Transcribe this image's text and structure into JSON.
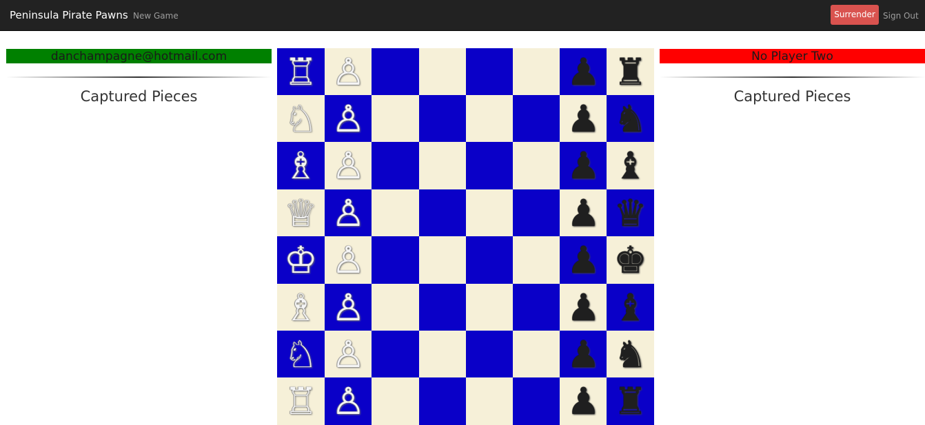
{
  "navbar": {
    "brand": "Peninsula Pirate Pawns",
    "new_game": "New Game",
    "surrender": "Surrender",
    "sign_out": "Sign Out"
  },
  "player_one": {
    "name": "danchampagne@hotmail.com",
    "color": "#008000"
  },
  "player_two": {
    "name": "No Player Two",
    "color": "#ff0000"
  },
  "captured_pieces_label": "Captured Pieces",
  "board": {
    "dark_color": "#0a00c8",
    "light_color": "#f6f0d8",
    "pieces": [
      [
        "wR",
        "wP",
        "",
        "",
        "",
        "",
        "bP",
        "bR"
      ],
      [
        "wN",
        "wP",
        "",
        "",
        "",
        "",
        "bP",
        "bN"
      ],
      [
        "wB",
        "wP",
        "",
        "",
        "",
        "",
        "bP",
        "bB"
      ],
      [
        "wQ",
        "wP",
        "",
        "",
        "",
        "",
        "bP",
        "bQ"
      ],
      [
        "wK",
        "wP",
        "",
        "",
        "",
        "",
        "bP",
        "bK"
      ],
      [
        "wB",
        "wP",
        "",
        "",
        "",
        "",
        "bP",
        "bB"
      ],
      [
        "wN",
        "wP",
        "",
        "",
        "",
        "",
        "bP",
        "bN"
      ],
      [
        "wR",
        "wP",
        "",
        "",
        "",
        "",
        "bP",
        "bR"
      ]
    ]
  }
}
